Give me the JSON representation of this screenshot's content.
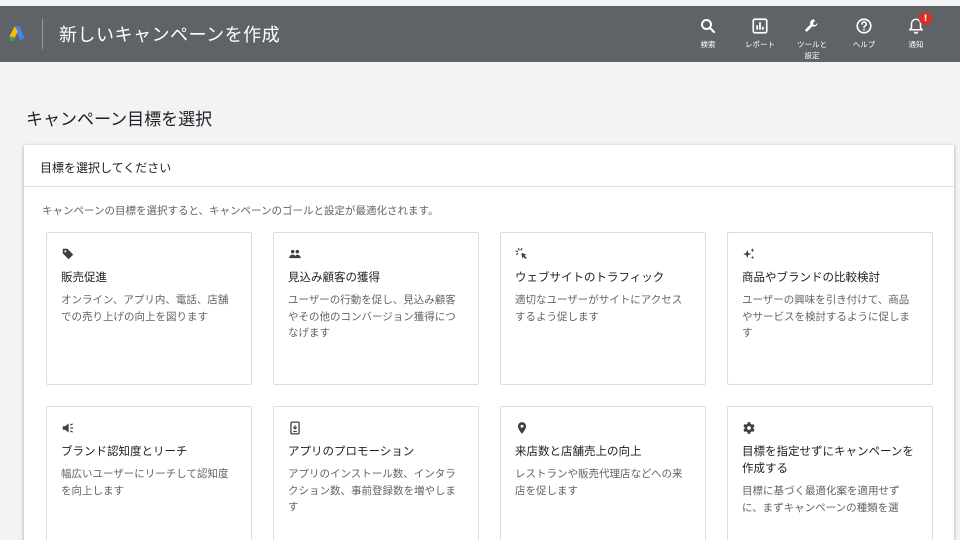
{
  "header": {
    "title": "新しいキャンペーンを作成",
    "tools": [
      {
        "label": "検索",
        "icon": "search-icon"
      },
      {
        "label": "レポート",
        "icon": "reports-icon"
      },
      {
        "label": "ツールと\n設定",
        "icon": "wrench-icon"
      },
      {
        "label": "ヘルプ",
        "icon": "help-icon"
      },
      {
        "label": "通知",
        "icon": "bell-icon",
        "badge": "!"
      }
    ]
  },
  "page": {
    "title": "キャンペーン目標を選択"
  },
  "panel": {
    "header": "目標を選択してください",
    "description": "キャンペーンの目標を選択すると、キャンペーンのゴールと設定が最適化されます。"
  },
  "goals": [
    {
      "icon": "tag-icon",
      "title": "販売促進",
      "description": "オンライン、アプリ内、電話、店舗での売り上げの向上を図ります"
    },
    {
      "icon": "people-icon",
      "title": "見込み顧客の獲得",
      "description": "ユーザーの行動を促し、見込み顧客やその他のコンバージョン獲得につなげます"
    },
    {
      "icon": "cursor-click-icon",
      "title": "ウェブサイトのトラフィック",
      "description": "適切なユーザーがサイトにアクセスするよう促します"
    },
    {
      "icon": "sparkle-icon",
      "title": "商品やブランドの比較検討",
      "description": "ユーザーの興味を引き付けて、商品やサービスを検討するように促します"
    },
    {
      "icon": "megaphone-icon",
      "title": "ブランド認知度とリーチ",
      "description": "幅広いユーザーにリーチして認知度を向上します"
    },
    {
      "icon": "phone-download-icon",
      "title": "アプリのプロモーション",
      "description": "アプリのインストール数、インタラクション数、事前登録数を増やします"
    },
    {
      "icon": "location-pin-icon",
      "title": "来店数と店舗売上の向上",
      "description": "レストランや販売代理店などへの来店を促します"
    },
    {
      "icon": "gear-icon",
      "title": "目標を指定せずにキャンペーンを作成する",
      "description": "目標に基づく最適化案を適用せずに、まずキャンペーンの種類を選"
    }
  ],
  "colors": {
    "topbar": "#5f6368",
    "badge": "#d93025",
    "logo_blue": "#4285f4",
    "logo_yellow": "#fbbc04",
    "logo_green": "#34a853"
  }
}
